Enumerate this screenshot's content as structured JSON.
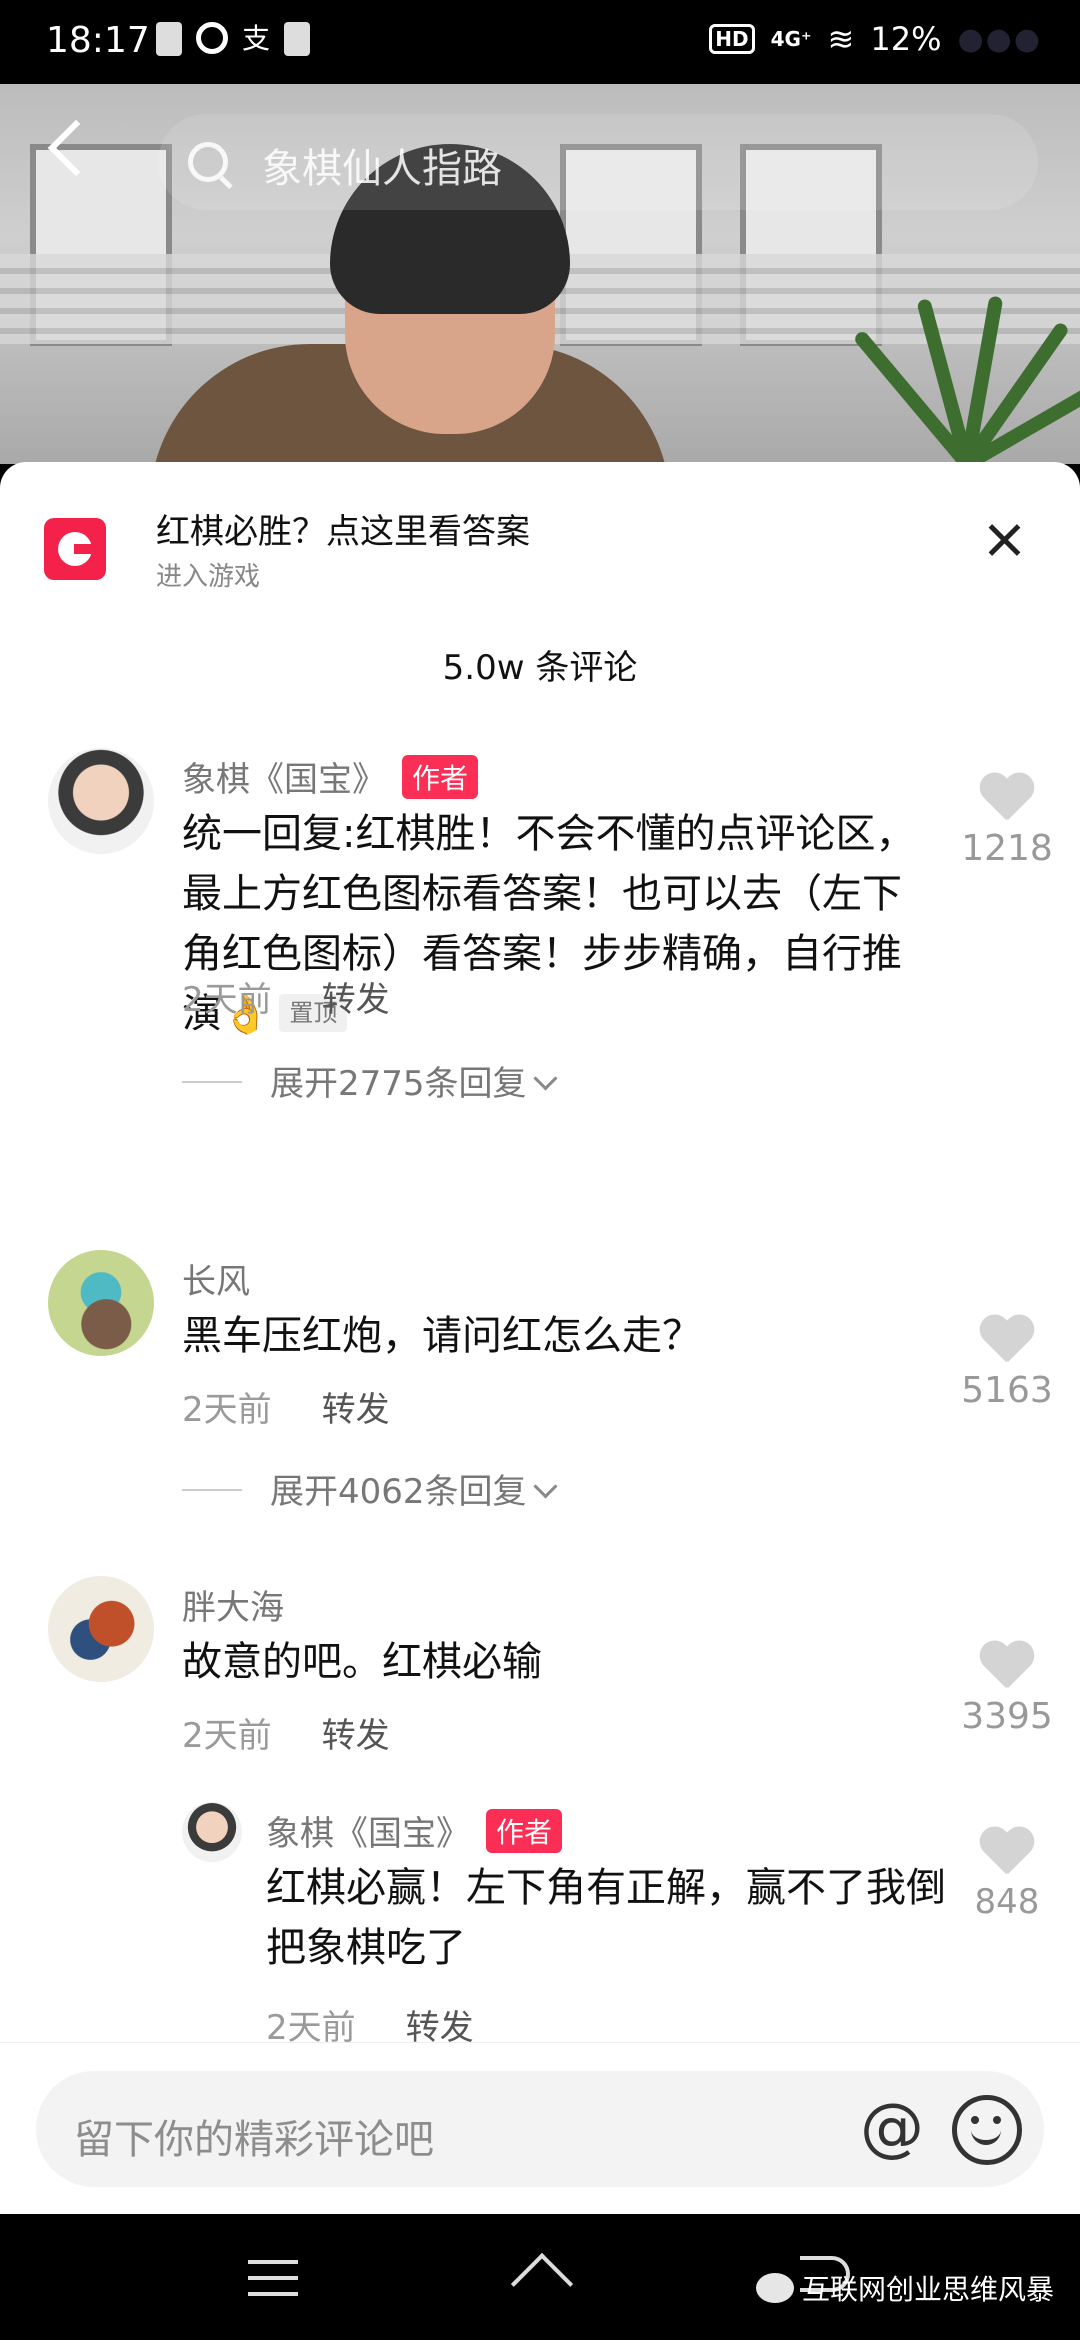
{
  "status_bar": {
    "time": "18:17",
    "left_glyph": "支",
    "hd": "HD",
    "network": "4G⁺",
    "battery": "12%",
    "dots": "●●●"
  },
  "header": {
    "search_text": "象棋仙人指路"
  },
  "promo": {
    "title": "红棋必胜？点这里看答案",
    "subtitle": "进入游戏"
  },
  "comment_count": "5.0w 条评论",
  "comments": [
    {
      "name": "象棋《国宝》",
      "badge": "作者",
      "text": "统一回复:红棋胜！不会不懂的点评论区，最上方红色图标看答案！也可以去（左下角红色图标）看答案！步步精确，自行推演",
      "emoji": "👌",
      "pin": "置顶",
      "time": "2天前",
      "share": "转发",
      "likes": "1218",
      "expand": "展开2775条回复"
    },
    {
      "name": "长风",
      "text": "黑车压红炮，请问红怎么走？",
      "time": "2天前",
      "share": "转发",
      "likes": "5163",
      "expand": "展开4062条回复"
    },
    {
      "name": "胖大海",
      "text": "故意的吧。红棋必输",
      "time": "2天前",
      "share": "转发",
      "likes": "3395"
    }
  ],
  "reply": {
    "name": "象棋《国宝》",
    "badge": "作者",
    "text": "红棋必赢！左下角有正解，赢不了我倒把象棋吃了",
    "time": "2天前",
    "share": "转发",
    "likes": "848"
  },
  "input": {
    "placeholder": "留下你的精彩评论吧",
    "at": "@"
  },
  "watermark": "互联网创业思维风暴",
  "colors": {
    "accent": "#fb2f55",
    "promo_logo": "#f4214a"
  }
}
